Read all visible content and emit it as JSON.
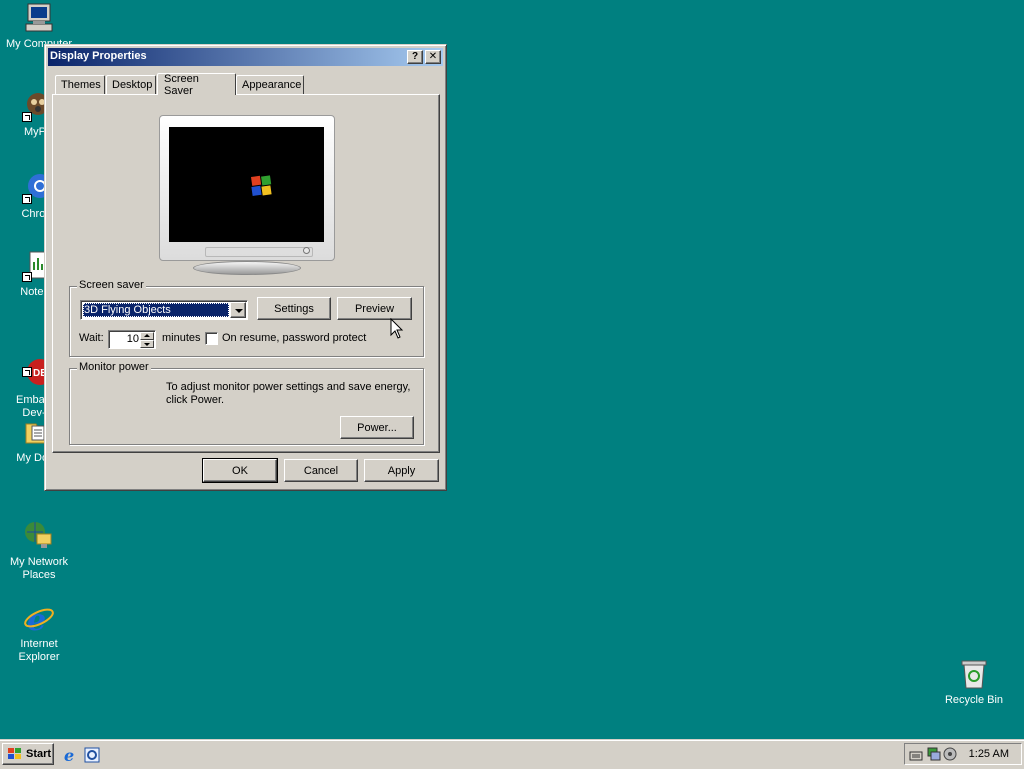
{
  "desktop": {
    "icons": [
      {
        "label": "My Computer"
      },
      {
        "label": "MyPa"
      },
      {
        "label": "Chrom"
      },
      {
        "label": "Notepa"
      },
      {
        "label": "Embarca\nDev-C"
      },
      {
        "label": "My Docu"
      },
      {
        "label": "My Network\nPlaces"
      },
      {
        "label": "Internet\nExplorer"
      },
      {
        "label": "Recycle Bin"
      }
    ]
  },
  "dialog": {
    "title": "Display Properties",
    "help_btn": "?",
    "close_btn": "✕",
    "tabs": [
      "Themes",
      "Desktop",
      "Screen Saver",
      "Appearance"
    ],
    "active_tab": "Screen Saver",
    "screen_saver": {
      "group_label": "Screen saver",
      "selected": "3D Flying Objects",
      "settings_btn": "Settings",
      "preview_btn": "Preview",
      "wait_label": "Wait:",
      "wait_value": "10",
      "minutes_label": "minutes",
      "password_label": "On resume, password protect",
      "password_checked": false
    },
    "monitor_power": {
      "group_label": "Monitor power",
      "description": "To adjust monitor power settings and save energy, click Power.",
      "power_btn": "Power..."
    },
    "buttons": {
      "ok": "OK",
      "cancel": "Cancel",
      "apply": "Apply"
    }
  },
  "taskbar": {
    "start_label": "Start",
    "clock": "1:25 AM"
  },
  "colors": {
    "desktop": "#008080",
    "titlebar_start": "#0a246a",
    "titlebar_end": "#a6caf0",
    "face": "#d4d0c8",
    "selection": "#0a246a"
  }
}
